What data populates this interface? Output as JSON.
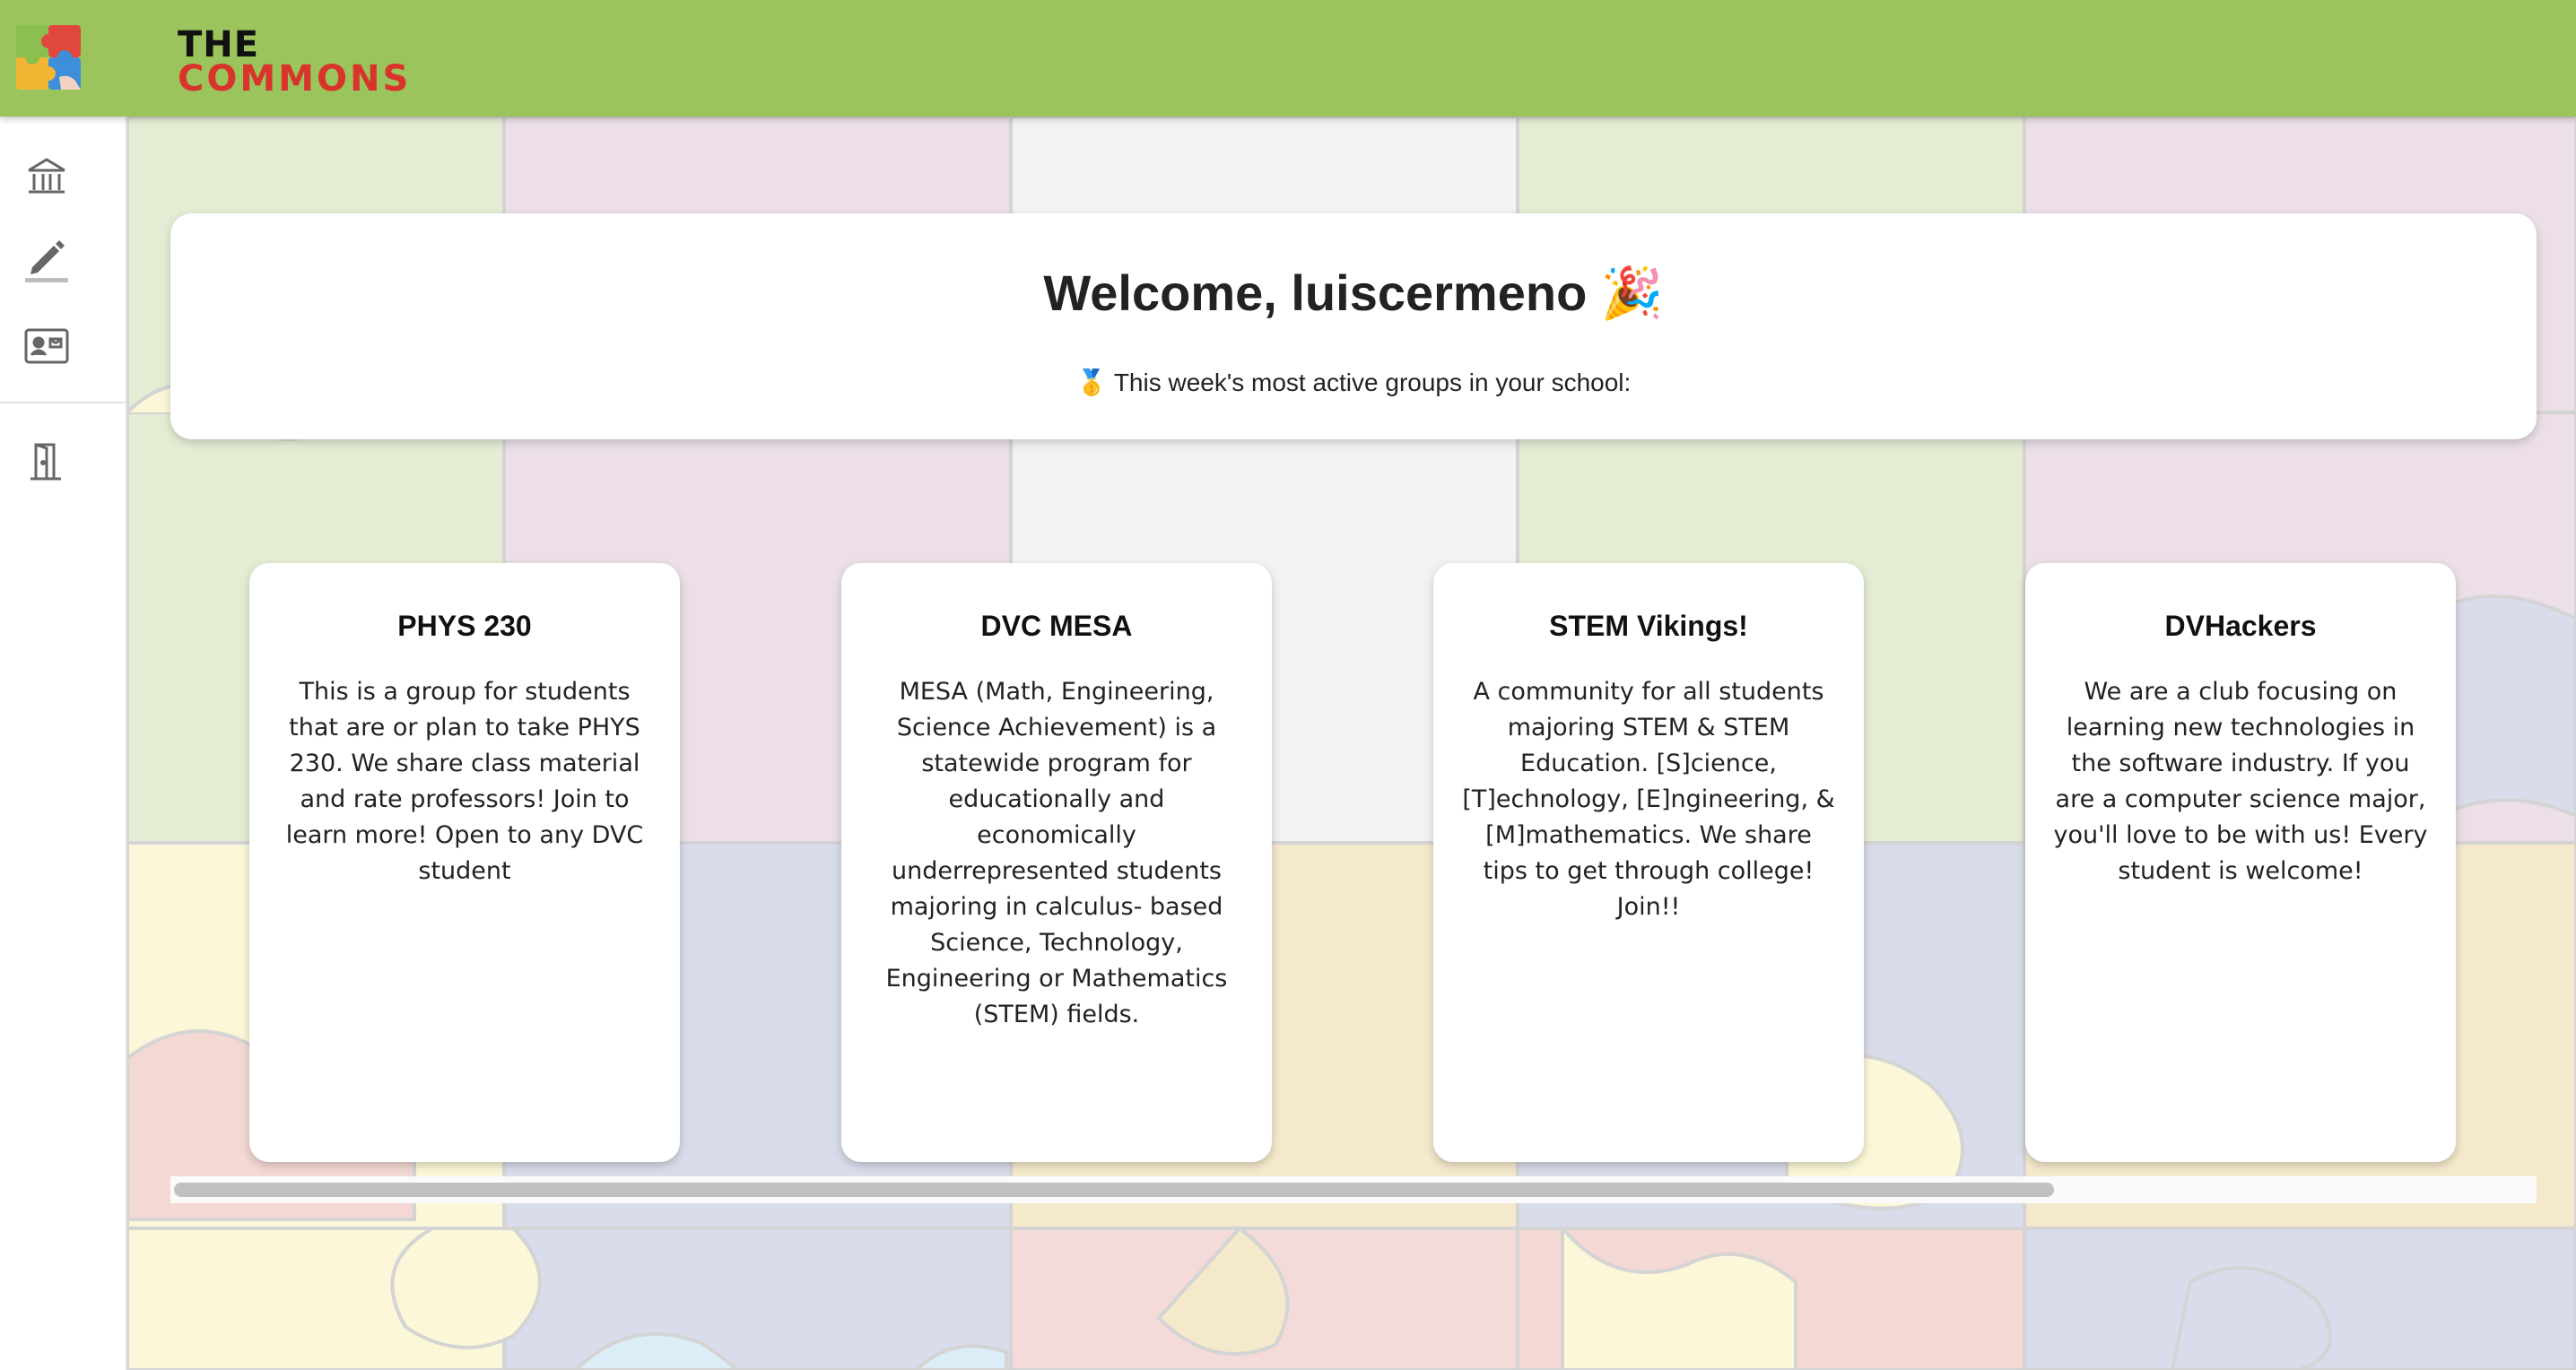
{
  "header": {
    "logo_icon": "puzzle-logo-icon",
    "wordmark_line1": "THE",
    "wordmark_line2": "COMMONS",
    "bar_color": "#9bc45c",
    "accent_red": "#d9342b"
  },
  "sidebar": {
    "items": [
      {
        "icon": "school-icon"
      },
      {
        "icon": "edit-pencil-icon"
      },
      {
        "icon": "contact-card-icon"
      },
      {
        "icon": "logout-door-icon"
      }
    ]
  },
  "welcome": {
    "title": "Welcome, luiscermeno 🎉",
    "subtitle": "🥇 This week's most active groups in your school:"
  },
  "groups": [
    {
      "title": "PHYS 230",
      "description": "This is a group for students that are or plan to take PHYS 230. We share class material and rate professors! Join to learn more! Open to any DVC student"
    },
    {
      "title": "DVC MESA",
      "description": "MESA (Math, Engineering, Science Achievement) is a statewide program for educationally and economically underrepresented students majoring in calculus- based Science, Technology, Engineering or Mathematics (STEM) fields."
    },
    {
      "title": "STEM Vikings!",
      "description": "A community for all students majoring STEM & STEM Education. [S]cience, [T]echnology, [E]ngineering, & [M]mathematics. We share tips to get through college! Join!!"
    },
    {
      "title": "DVHackers",
      "description": "We are a club focusing on learning new technologies in the software industry. If you are a computer science major, you'll love to be with us! Every student is welcome!"
    }
  ]
}
